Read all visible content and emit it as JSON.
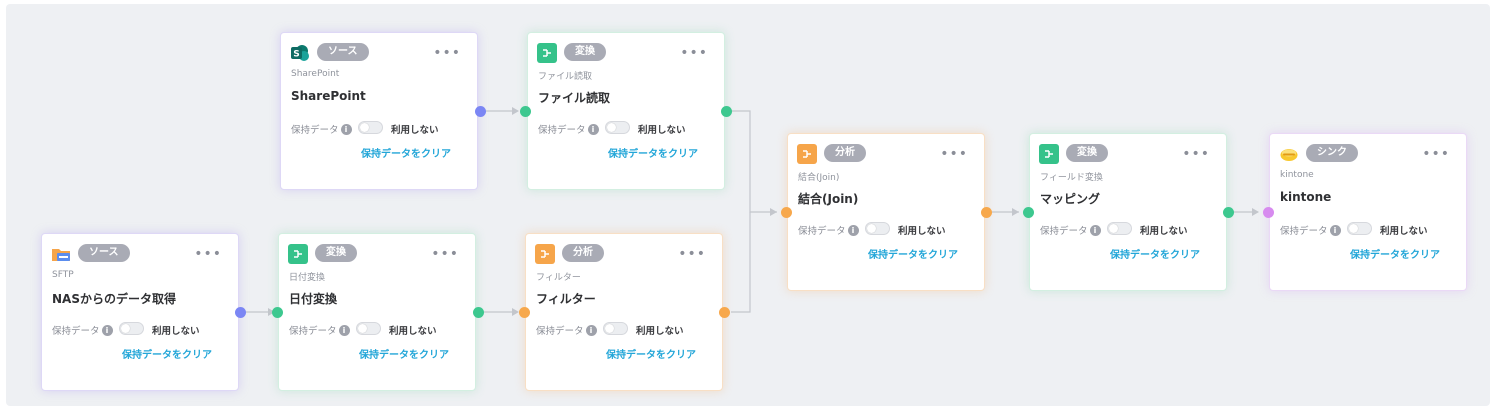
{
  "common": {
    "keep_label": "保持データ",
    "info_mark": "i",
    "toggle_label": "利用しない",
    "clear_label": "保持データをクリア",
    "menu": "•••"
  },
  "colors": {
    "source_port": "#7b86f4",
    "transform": "#35c28a",
    "analysis": "#f6a54a",
    "sink_port": "#d78bef",
    "link": "#23a6d8",
    "tag_bg": "#a9abb5"
  },
  "nodes": [
    {
      "key": "sharepoint",
      "icon": "sharepoint-icon",
      "tag": "ソース",
      "subtitle": "SharePoint",
      "title": "SharePoint"
    },
    {
      "key": "file-read",
      "icon": "transform-icon",
      "tag": "変換",
      "subtitle": "ファイル読取",
      "title": "ファイル読取"
    },
    {
      "key": "join",
      "icon": "analysis-icon",
      "tag": "分析",
      "subtitle": "結合(Join)",
      "title": "結合(Join)"
    },
    {
      "key": "mapping",
      "icon": "transform-icon",
      "tag": "変換",
      "subtitle": "フィールド変換",
      "title": "マッピング"
    },
    {
      "key": "kintone",
      "icon": "kintone-icon",
      "tag": "シンク",
      "subtitle": "kintone",
      "title": "kintone"
    },
    {
      "key": "sftp",
      "icon": "nas-folder-icon",
      "tag": "ソース",
      "subtitle": "SFTP",
      "title": "NASからのデータ取得"
    },
    {
      "key": "date-convert",
      "icon": "transform-icon",
      "tag": "変換",
      "subtitle": "日付変換",
      "title": "日付変換"
    },
    {
      "key": "filter",
      "icon": "analysis-icon",
      "tag": "分析",
      "subtitle": "フィルター",
      "title": "フィルター"
    }
  ]
}
